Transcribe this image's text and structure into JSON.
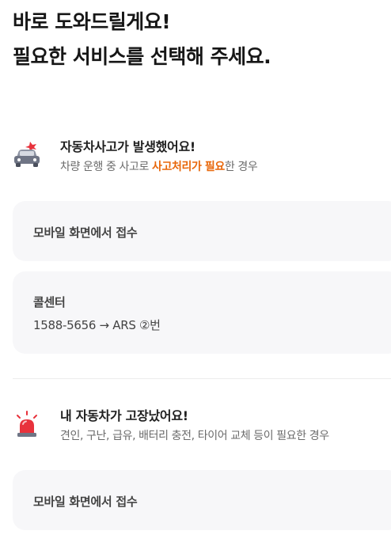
{
  "page": {
    "title_line1": "바로 도와드릴게요!",
    "title_line2": "필요한 서비스를 선택해 주세요."
  },
  "accident": {
    "icon": "car-accident-icon",
    "heading": "자동차사고가 발생했어요!",
    "desc_prefix": "차량 운행 중 사고로 ",
    "desc_highlight": "사고처리가 필요",
    "desc_suffix": "한 경우",
    "mobile_label": "모바일 화면에서 접수",
    "call_label": "콜센터",
    "call_detail": "1588-5656 → ARS ②번"
  },
  "breakdown": {
    "icon": "emergency-siren-icon",
    "heading": "내 자동차가 고장났어요!",
    "desc": "견인, 구난, 급유, 배터리 충전, 타이어 교체 등이 필요한 경우",
    "mobile_label": "모바일 화면에서 접수"
  },
  "colors": {
    "highlight": "#e8670a",
    "card_bg": "#f7f7f9",
    "siren_red": "#e8323c"
  }
}
